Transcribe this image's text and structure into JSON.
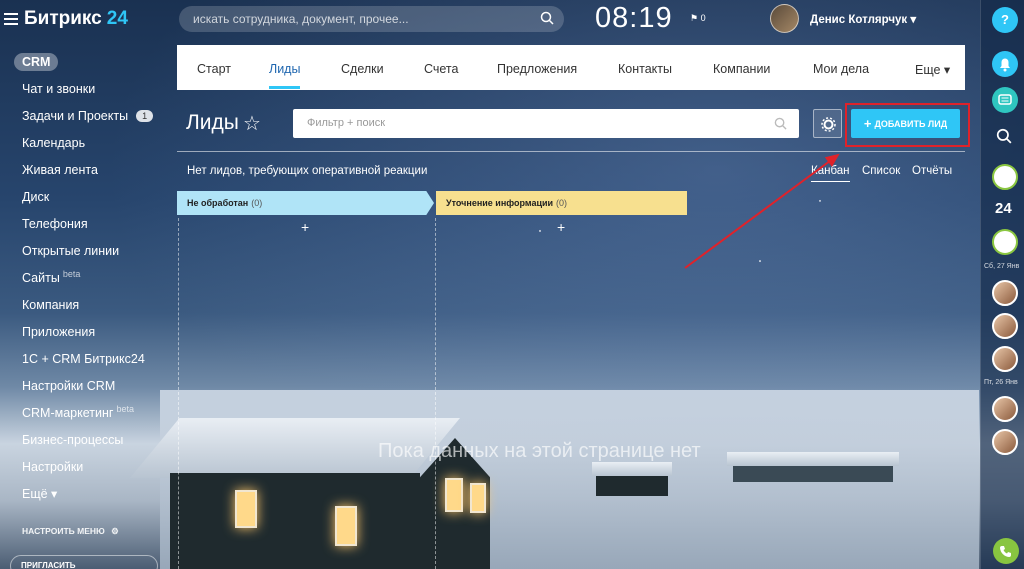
{
  "app": {
    "logo_text": "Битрикс",
    "logo_num": "24"
  },
  "header": {
    "search_placeholder": "искать сотрудника, документ, прочее...",
    "clock": "08:19",
    "flag_count": "0",
    "user_name": "Денис Котлярчук ▾"
  },
  "sidebar": {
    "items": [
      {
        "label": "CRM",
        "active": true
      },
      {
        "label": "Чат и звонки"
      },
      {
        "label": "Задачи и Проекты",
        "badge": "1"
      },
      {
        "label": "Календарь"
      },
      {
        "label": "Живая лента"
      },
      {
        "label": "Диск"
      },
      {
        "label": "Телефония"
      },
      {
        "label": "Открытые линии"
      },
      {
        "label": "Сайты",
        "sup": "beta"
      },
      {
        "label": "Компания"
      },
      {
        "label": "Приложения"
      },
      {
        "label": "1С + CRM Битрикс24"
      },
      {
        "label": "Настройки CRM"
      },
      {
        "label": "CRM-маркетинг",
        "sup": "beta"
      },
      {
        "label": "Бизнес-процессы"
      },
      {
        "label": "Настройки"
      },
      {
        "label": "Ещё ▾"
      }
    ],
    "setup_menu": "НАСТРОИТЬ МЕНЮ",
    "invite": "ПРИГЛАСИТЬ СОТРУДНИКОВ"
  },
  "nav": {
    "tabs": [
      {
        "label": "Старт"
      },
      {
        "label": "Лиды",
        "active": true
      },
      {
        "label": "Сделки"
      },
      {
        "label": "Счета"
      },
      {
        "label": "Предложения"
      },
      {
        "label": "Контакты"
      },
      {
        "label": "Компании"
      },
      {
        "label": "Мои дела"
      },
      {
        "label": "Еще ▾"
      }
    ]
  },
  "toolbar": {
    "title": "Лиды",
    "filter_placeholder": "Фильтр + поиск",
    "add_button": "ДОБАВИТЬ ЛИД"
  },
  "view": {
    "no_leads": "Нет лидов, требующих оперативной реакции",
    "tabs": [
      "Канбан",
      "Список",
      "Отчёты"
    ]
  },
  "kanban": {
    "columns": [
      {
        "title": "Не обработан",
        "count": "(0)",
        "color": "#b0e4f7"
      },
      {
        "title": "Уточнение информации",
        "count": "(0)",
        "color": "#f7e08f"
      }
    ]
  },
  "empty_message": "Пока данных на этой странице нет",
  "rightbar": {
    "help": "?",
    "b24": "24",
    "dates": [
      "Сб, 27 Янв",
      "Пт, 26 Янв"
    ]
  },
  "colors": {
    "accent": "#2fc6f6",
    "highlight": "#e0222a"
  }
}
